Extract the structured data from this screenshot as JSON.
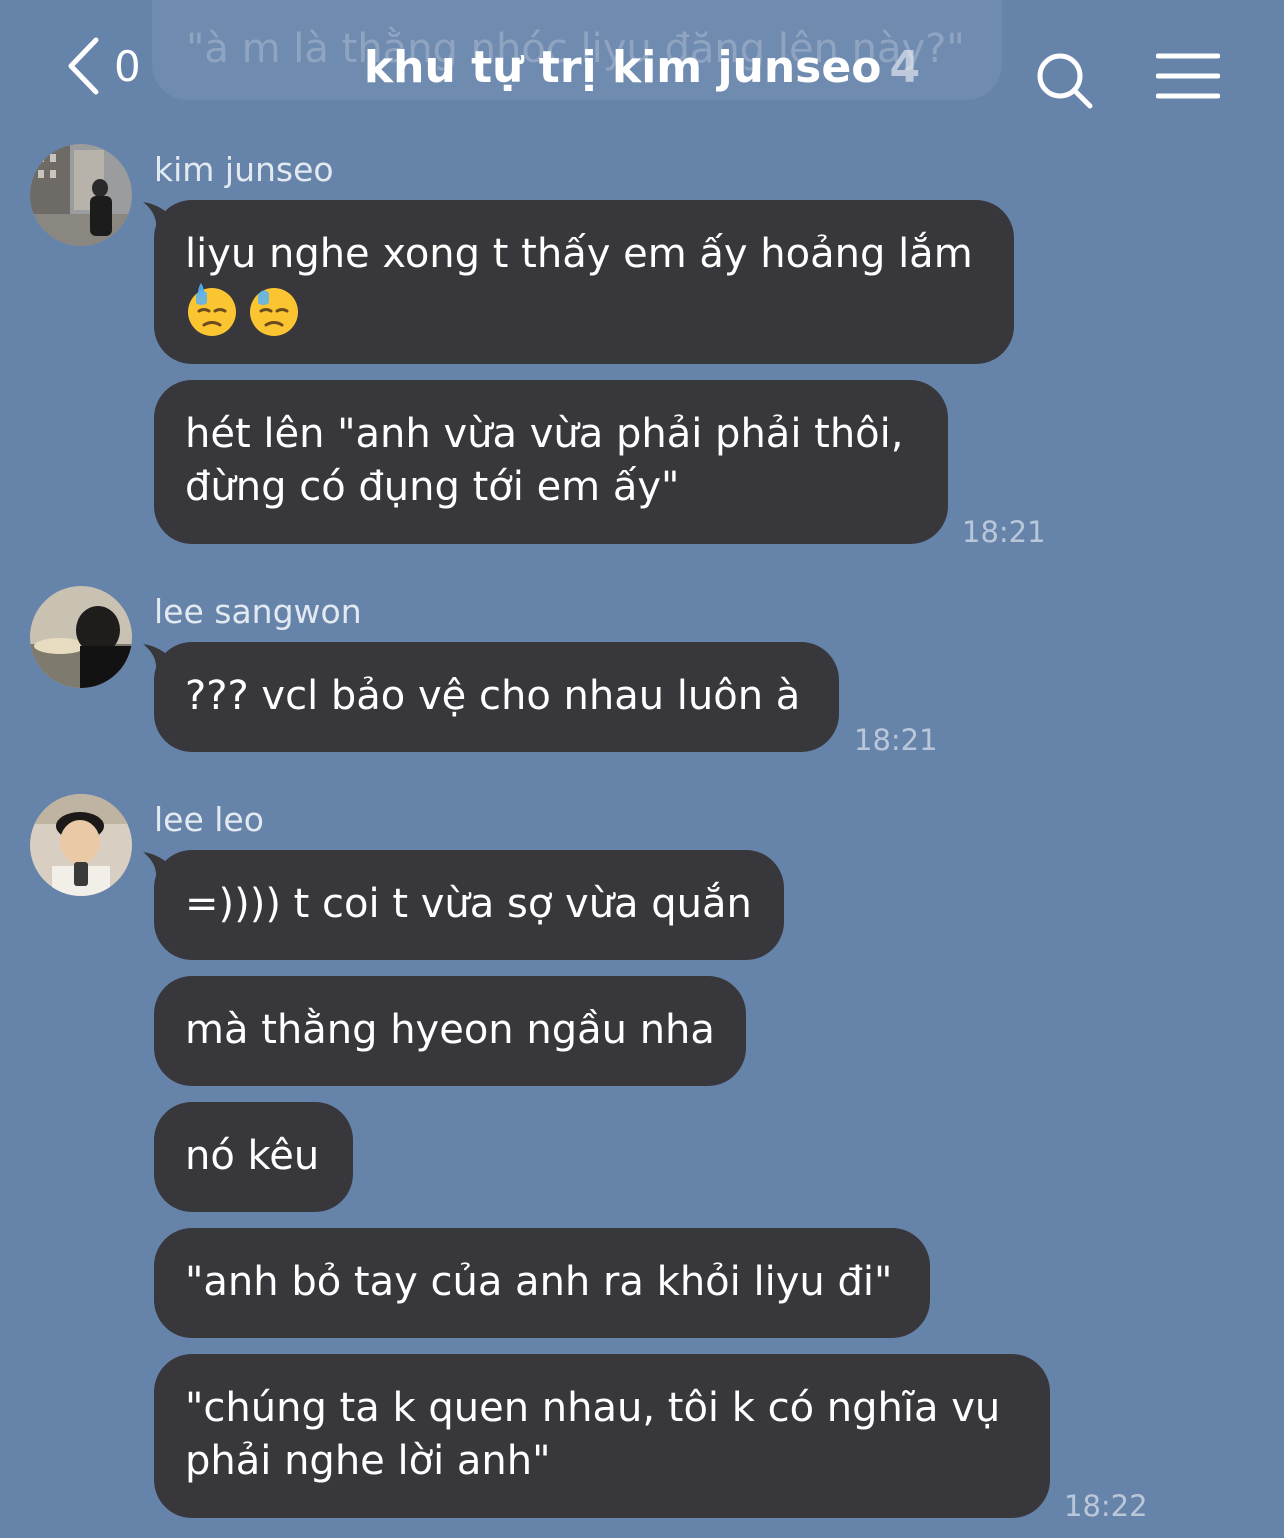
{
  "header": {
    "ghost_preview": "\"à m là thằng nhóc liyu đăng lên này?\"",
    "back_count": "0",
    "title": "khu tự trị kim junseo",
    "member_count": "4"
  },
  "groups": [
    {
      "sender": "kim junseo",
      "messages": [
        {
          "line1": "liyu nghe xong t thấy em ấy hoảng lắm",
          "emoji": [
            "downcast-face-with-sweat",
            "downcast-face-with-sweat"
          ]
        },
        {
          "line1": "hét lên \"anh vừa vừa phải phải thôi,",
          "line2": "đừng có đụng tới em ấy\""
        }
      ],
      "time": "18:21"
    },
    {
      "sender": "lee sangwon",
      "messages": [
        {
          "line1": "??? vcl bảo vệ cho nhau luôn à"
        }
      ],
      "time": "18:21"
    },
    {
      "sender": "lee leo",
      "messages": [
        {
          "line1": "=)))) t coi t vừa sợ vừa quắn"
        },
        {
          "line1": "mà thằng hyeon ngầu nha"
        },
        {
          "line1": "nó kêu"
        },
        {
          "line1": "\"anh bỏ tay của anh ra khỏi liyu đi\""
        },
        {
          "line1": "\"chúng ta k quen nhau, tôi k có nghĩa vụ",
          "line2": "phải nghe lời anh\""
        }
      ],
      "time": "18:22"
    }
  ],
  "colors": {
    "background": "#6683aa",
    "bubble": "#38383c",
    "text": "#ffffff"
  }
}
